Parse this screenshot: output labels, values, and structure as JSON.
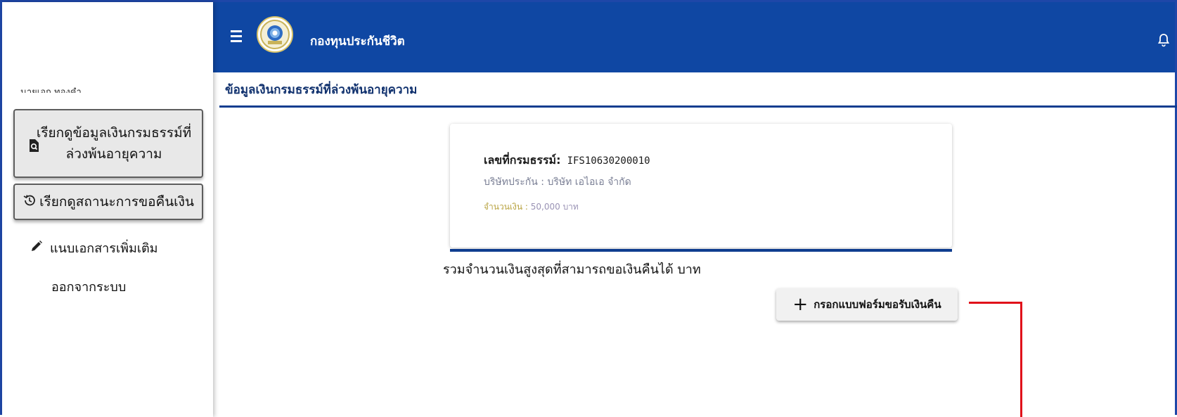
{
  "header": {
    "app_title": "กองทุนประกันชีวิต",
    "logo": "life-insurance-fund-seal",
    "bg_color": "#0f47a3"
  },
  "sidebar": {
    "user_label": "นายเอก ทองคำ",
    "buttons": [
      {
        "label": "เรียกดูข้อมูลเงินกรมธรรม์ที่ล่วงพ้นอายุความ",
        "icon": "document-search-icon"
      },
      {
        "label": "เรียกดูสถานะการขอคืนเงิน",
        "icon": "history-icon"
      }
    ],
    "links": [
      {
        "label": "แนบเอกสารเพิ่มเติม",
        "icon": "pencil-icon"
      },
      {
        "label": "ออกจากระบบ"
      }
    ]
  },
  "breadcrumb": {
    "title": "ข้อมูลเงินกรมธรรม์ที่ล่วงพ้นอายุความ"
  },
  "policy_card": {
    "policy_label": "เลขที่กรมธรรม์:",
    "policy_number": "IFS10630200010",
    "company_label": "บริษัทประกัน :",
    "company_name": "บริษัท เอไอเอ จำกัด",
    "amount_label": "จำนวนเงิน :",
    "amount_value": "50,000 บาท"
  },
  "summary": {
    "total_text": "รวมจำนวนเงินสูงสุดที่สามารถขอเงินคืนได้ บาท"
  },
  "actions": {
    "add_form_label": "กรอกแบบฟอร์มขอรับเงินคืน"
  },
  "colors": {
    "accent_blue": "#0f47a3",
    "callout_red": "#e0101a",
    "amount_gold": "#b8a340"
  }
}
